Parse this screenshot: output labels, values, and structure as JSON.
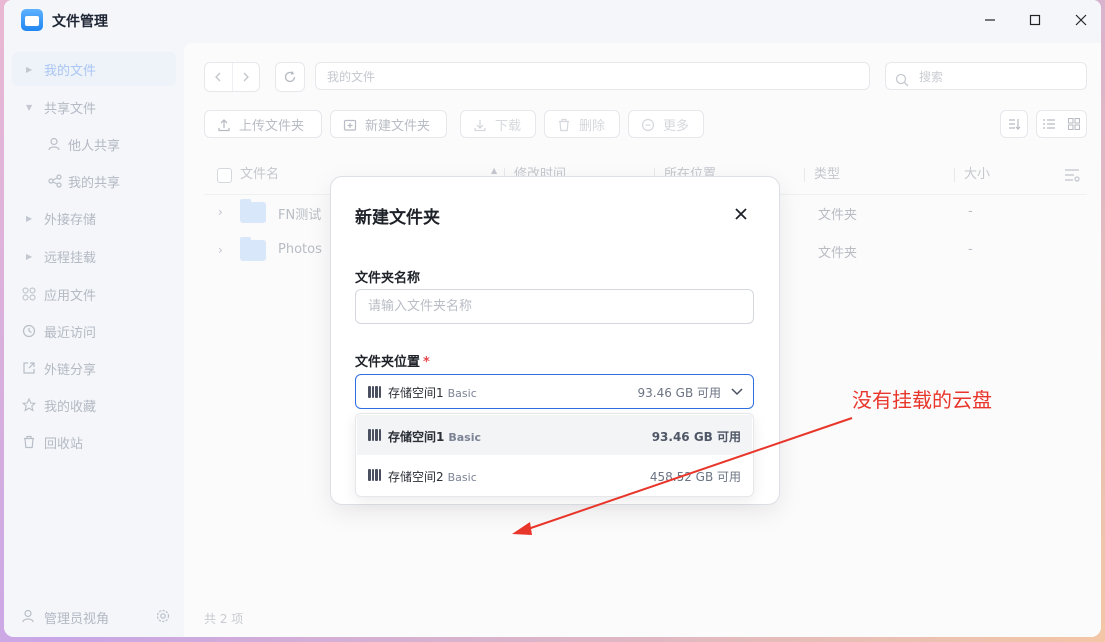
{
  "app": {
    "title": "文件管理"
  },
  "window_controls": {
    "minimize": "minimize",
    "maximize": "maximize",
    "close": "close"
  },
  "sidebar": {
    "items": [
      {
        "label": "我的文件",
        "icon": "caret-right-icon",
        "active": true
      },
      {
        "label": "共享文件",
        "icon": "caret-down-icon"
      },
      {
        "label": "他人共享",
        "icon": "users-icon",
        "child": true
      },
      {
        "label": "我的共享",
        "icon": "share-icon",
        "child": true
      },
      {
        "label": "外接存储",
        "icon": "caret-right-icon"
      },
      {
        "label": "远程挂载",
        "icon": "caret-right-icon"
      },
      {
        "label": "应用文件",
        "icon": "apps-icon"
      },
      {
        "label": "最近访问",
        "icon": "clock-icon"
      },
      {
        "label": "外链分享",
        "icon": "external-link-icon"
      },
      {
        "label": "我的收藏",
        "icon": "star-icon"
      },
      {
        "label": "回收站",
        "icon": "trash-icon"
      }
    ],
    "footer_label": "管理员视角"
  },
  "toolbar": {
    "path": "我的文件",
    "search_placeholder": "搜索",
    "upload_label": "上传文件夹",
    "new_folder_label": "新建文件夹",
    "download_label": "下载",
    "delete_label": "删除",
    "more_label": "更多"
  },
  "table": {
    "headers": [
      "文件名",
      "修改时间",
      "所在位置",
      "类型",
      "大小"
    ],
    "rows": [
      {
        "name": "FN测试",
        "type": "文件夹",
        "size": "-"
      },
      {
        "name": "Photos",
        "type": "文件夹",
        "size": "-"
      }
    ],
    "count_text": "共 2 项"
  },
  "modal": {
    "title": "新建文件夹",
    "name_label": "文件夹名称",
    "name_placeholder": "请输入文件夹名称",
    "location_label": "文件夹位置",
    "required_mark": "*",
    "selected": {
      "name": "存储空间1",
      "tag": "Basic",
      "free": "93.46 GB 可用"
    },
    "options": [
      {
        "name": "存储空间1",
        "tag": "Basic",
        "free": "93.46 GB 可用"
      },
      {
        "name": "存储空间2",
        "tag": "Basic",
        "free": "458.52 GB 可用"
      }
    ]
  },
  "annotation": {
    "text": "没有挂载的云盘",
    "color": "#e8362b"
  },
  "colors": {
    "accent": "#2f6fe4",
    "folder": "#d9e7fb"
  }
}
